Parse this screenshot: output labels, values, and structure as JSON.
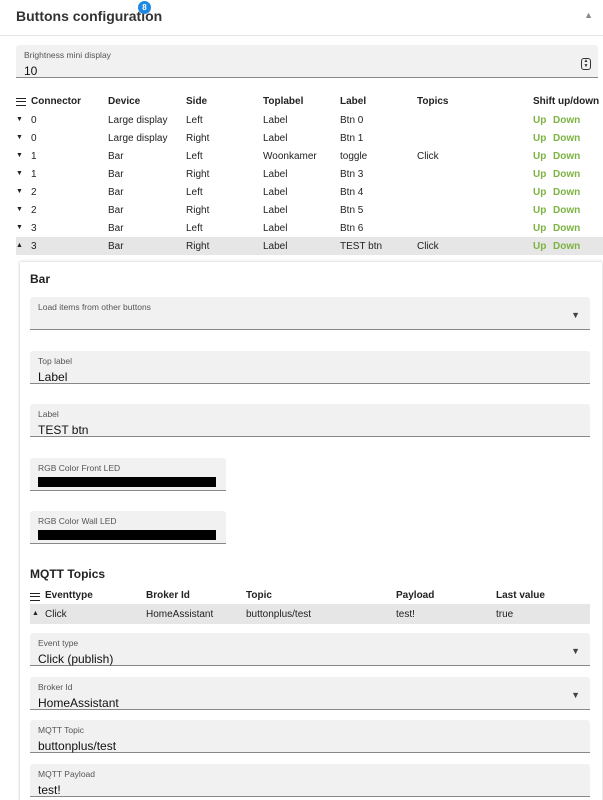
{
  "header": {
    "title": "Buttons configuration",
    "badge": "8",
    "collapse_icon": "caret-up-icon"
  },
  "brightness": {
    "label": "Brightness mini display",
    "value": "10"
  },
  "buttons_table": {
    "columns": [
      "Connector",
      "Device",
      "Side",
      "Toplabel",
      "Label",
      "Topics",
      "Shift up/down"
    ],
    "up_label": "Up",
    "down_label": "Down",
    "rows": [
      {
        "connector": "0",
        "device": "Large display",
        "side": "Left",
        "toplabel": "Label",
        "label": "Btn 0",
        "topics": "",
        "expanded": false
      },
      {
        "connector": "0",
        "device": "Large display",
        "side": "Right",
        "toplabel": "Label",
        "label": "Btn 1",
        "topics": "",
        "expanded": false
      },
      {
        "connector": "1",
        "device": "Bar",
        "side": "Left",
        "toplabel": "Woonkamer",
        "label": "toggle",
        "topics": "Click",
        "expanded": false
      },
      {
        "connector": "1",
        "device": "Bar",
        "side": "Right",
        "toplabel": "Label",
        "label": "Btn 3",
        "topics": "",
        "expanded": false
      },
      {
        "connector": "2",
        "device": "Bar",
        "side": "Left",
        "toplabel": "Label",
        "label": "Btn 4",
        "topics": "",
        "expanded": false
      },
      {
        "connector": "2",
        "device": "Bar",
        "side": "Right",
        "toplabel": "Label",
        "label": "Btn 5",
        "topics": "",
        "expanded": false
      },
      {
        "connector": "3",
        "device": "Bar",
        "side": "Left",
        "toplabel": "Label",
        "label": "Btn 6",
        "topics": "",
        "expanded": false
      },
      {
        "connector": "3",
        "device": "Bar",
        "side": "Right",
        "toplabel": "Label",
        "label": "TEST btn",
        "topics": "Click",
        "expanded": true
      }
    ]
  },
  "detail": {
    "title": "Bar",
    "load_items": {
      "label": "Load items from other buttons",
      "value": ""
    },
    "top_label": {
      "label": "Top label",
      "value": "Label"
    },
    "label": {
      "label": "Label",
      "value": "TEST btn"
    },
    "rgb_front": {
      "label": "RGB Color Front LED",
      "color": "#000000"
    },
    "rgb_wall": {
      "label": "RGB Color Wall LED",
      "color": "#000000"
    }
  },
  "mqtt": {
    "title": "MQTT Topics",
    "columns": [
      "Eventtype",
      "Broker Id",
      "Topic",
      "Payload",
      "Last value"
    ],
    "row": {
      "eventtype": "Click",
      "broker": "HomeAssistant",
      "topic": "buttonplus/test",
      "payload": "test!",
      "last_value": "true"
    },
    "event_type": {
      "label": "Event type",
      "value": "Click (publish)"
    },
    "broker_id": {
      "label": "Broker Id",
      "value": "HomeAssistant"
    },
    "mqtt_topic": {
      "label": "MQTT Topic",
      "value": "buttonplus/test"
    },
    "mqtt_payload": {
      "label": "MQTT Payload",
      "value": "test!"
    }
  },
  "colors": {
    "accent": "#1e88e5",
    "shift": "#7cb342",
    "selected_row": "#e6e6e6",
    "field_bg": "#f1f1f1"
  }
}
